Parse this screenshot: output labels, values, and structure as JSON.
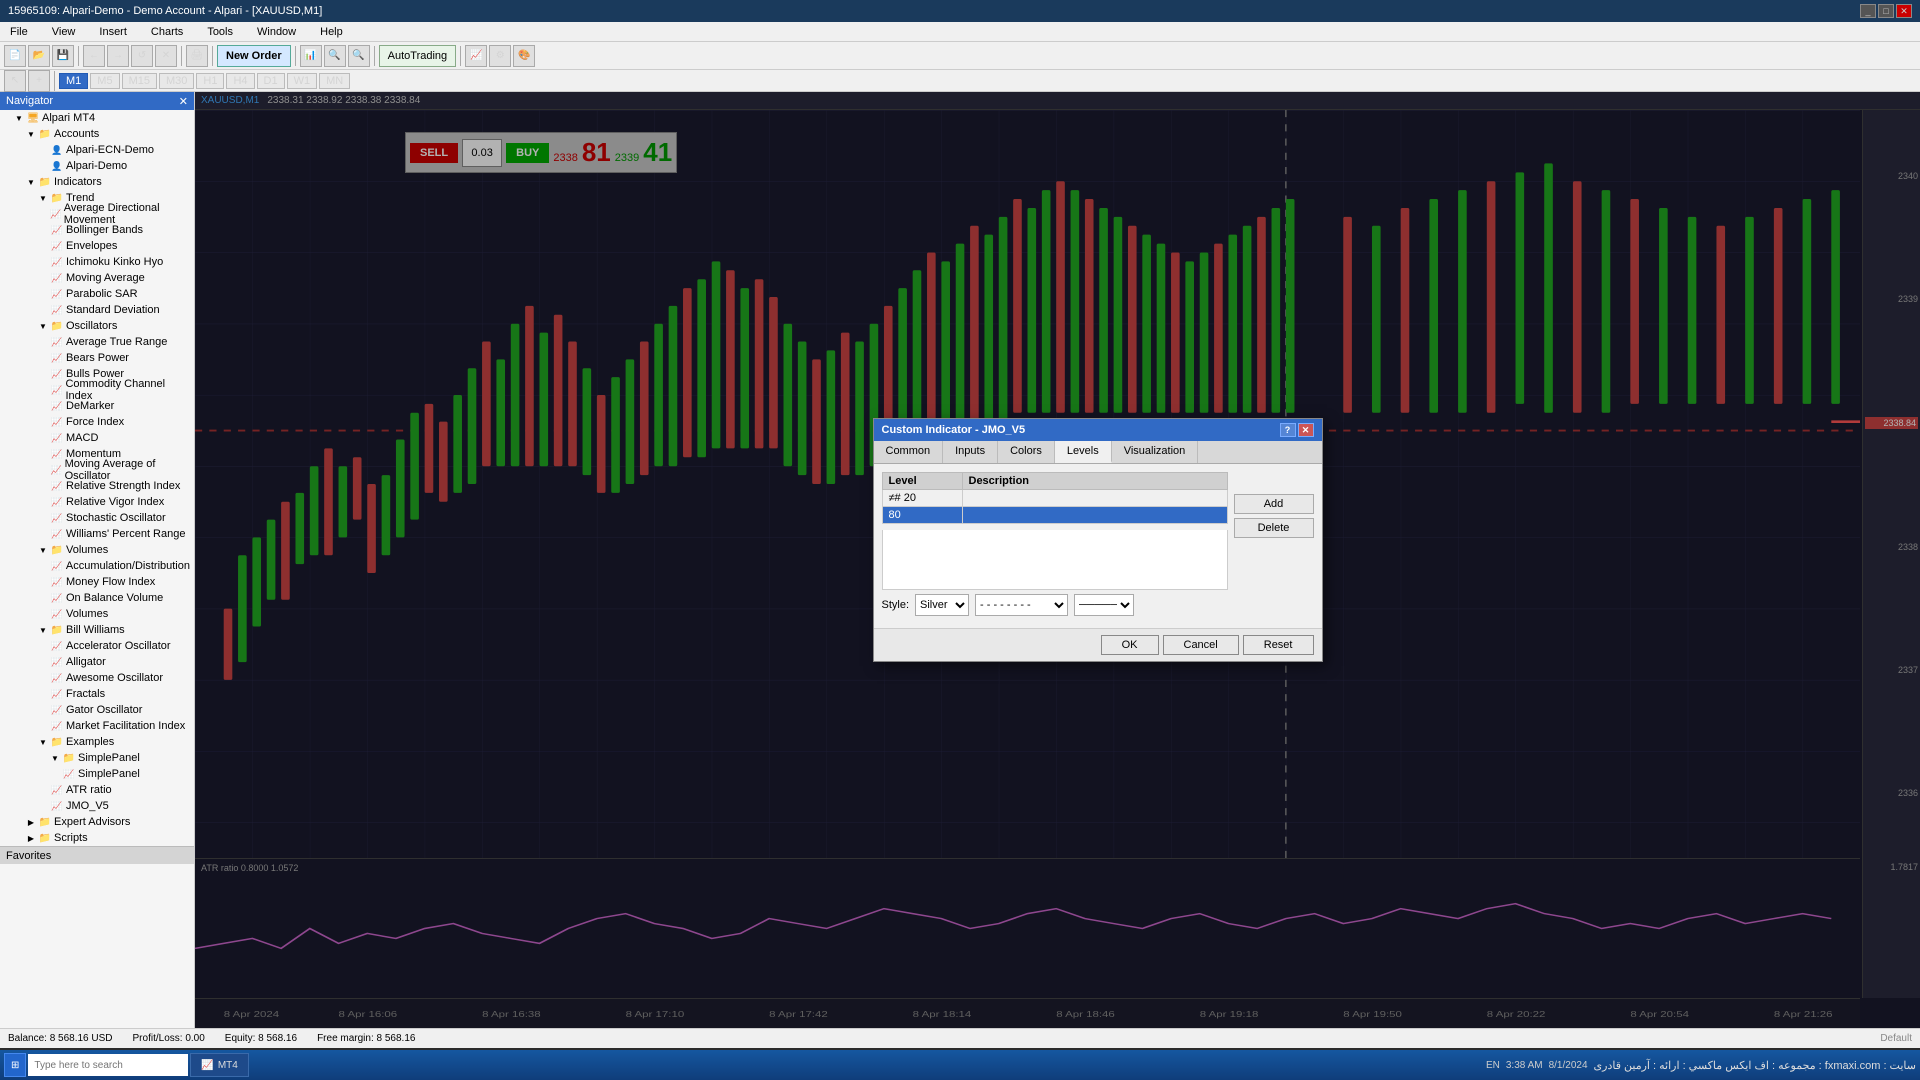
{
  "titleBar": {
    "title": "15965109: Alpari-Demo - Demo Account - Alpari - [XAUUSD,M1]",
    "buttons": [
      "_",
      "□",
      "✕"
    ]
  },
  "menuBar": {
    "items": [
      "File",
      "View",
      "Insert",
      "Charts",
      "Tools",
      "Window",
      "Help"
    ]
  },
  "toolbar": {
    "newOrderLabel": "New Order",
    "autoTradeLabel": "AutoTrading"
  },
  "timeframes": {
    "items": [
      "M1",
      "M5",
      "M15",
      "M30",
      "H1",
      "H4",
      "D1",
      "W1",
      "MN"
    ],
    "active": "M1"
  },
  "navigator": {
    "title": "Navigator",
    "sections": {
      "alpariMT4": "Alpari MT4",
      "accounts": "Accounts",
      "accountItems": [
        "Alpari-ECN-Demo",
        "Alpari-Demo"
      ],
      "indicators": "Indicators",
      "trend": "Trend",
      "trendItems": [
        "Average Directional Movement",
        "Bollinger Bands",
        "Envelopes",
        "Ichimoku Kinko Hyo",
        "Moving Average",
        "Parabolic SAR",
        "Standard Deviation"
      ],
      "oscillators": "Oscillators",
      "oscillatorItems": [
        "Average True Range",
        "Bears Power",
        "Bulls Power",
        "Commodity Channel Index",
        "DeMarker",
        "Force Index",
        "MACD",
        "Momentum",
        "Moving Average of Oscillator",
        "Relative Strength Index",
        "Relative Vigor Index",
        "Stochastic Oscillator",
        "Williams' Percent Range"
      ],
      "volumes": "Volumes",
      "volumeItems": [
        "Accumulation/Distribution",
        "Money Flow Index",
        "On Balance Volume",
        "Volumes"
      ],
      "billWilliams": "Bill Williams",
      "billItems": [
        "Accelerator Oscillator",
        "Alligator",
        "Awesome Oscillator",
        "Fractals",
        "Gator Oscillator",
        "Market Facilitation Index"
      ],
      "examples": "Examples",
      "exampleItems": [
        "SimplePanel",
        "ATR ratio",
        "JMO_V5"
      ],
      "expertAdvisors": "Expert Advisors",
      "scripts": "Scripts"
    }
  },
  "chart": {
    "symbol": "XAUUSD,M1",
    "headerInfo": "2338.31 2338.92 2338.38 2338.84",
    "sell": "SELL",
    "buy": "BUY",
    "sellPrice": "2338",
    "buyPrice": "2339",
    "sellNum": "81",
    "buyNum": "41",
    "spreadValue": "0.03",
    "priceScale": [
      "2340",
      "2339",
      "2338",
      "2337",
      "2336"
    ],
    "atrLabel": "ATR ratio 0.8000 1.0572",
    "atrScale": [
      "1.7817"
    ]
  },
  "modal": {
    "title": "Custom Indicator - JMO_V5",
    "tabs": [
      "Common",
      "Inputs",
      "Colors",
      "Levels",
      "Visualization"
    ],
    "activeTab": "Levels",
    "tableHeaders": [
      "Level",
      "Description"
    ],
    "tableRows": [
      {
        "level": "20",
        "description": "",
        "selected": false
      },
      {
        "level": "80",
        "description": "",
        "selected": true
      }
    ],
    "buttons": {
      "add": "Add",
      "delete": "Delete"
    },
    "styleLabel": "Style:",
    "styleColor": "Silver",
    "footer": {
      "ok": "OK",
      "cancel": "Cancel",
      "reset": "Reset"
    }
  },
  "statusBar": {
    "balance": "Balance: 8 568.16 USD",
    "profitLoss": "Profit/Loss: 0.00",
    "equity": "Equity: 8 568.16",
    "freeMargin": "Free margin: 8 568.16"
  },
  "windowsTaskbar": {
    "searchPlaceholder": "Type here to search",
    "apps": [
      "MT4"
    ],
    "rightSide": {
      "lang": "EN",
      "time": "3:38 AM",
      "date": "8/1/2024"
    }
  },
  "favoritesLabel": "Favorites"
}
